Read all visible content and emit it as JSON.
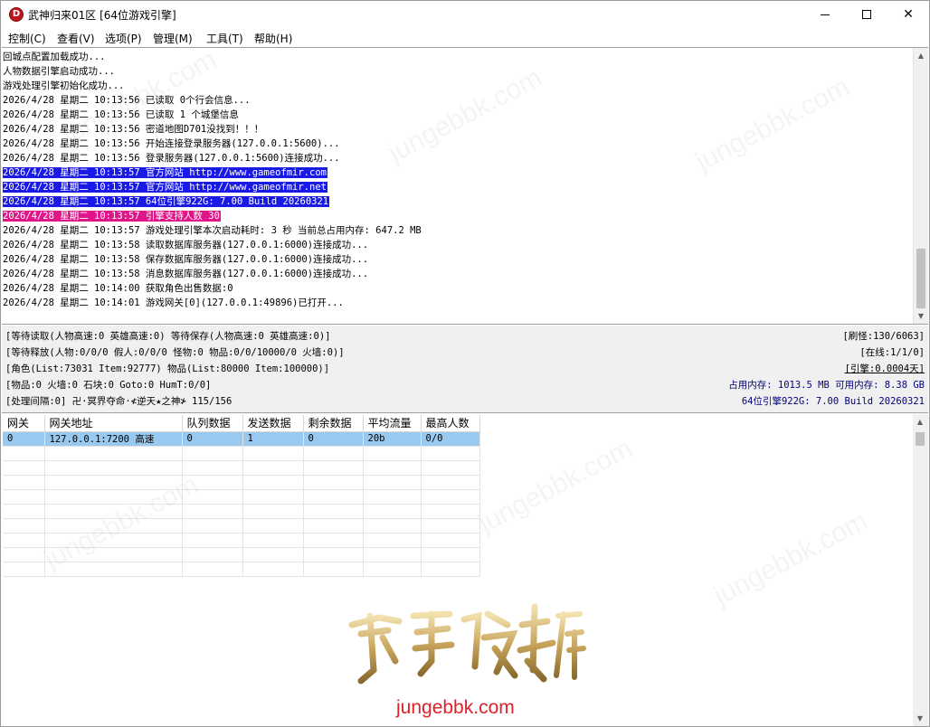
{
  "window": {
    "title": "武神归来01区 [64位游戏引擎]",
    "icon_letter": "D",
    "controls": {
      "minimize": "minimize-icon",
      "maximize": "maximize-icon",
      "close": "✕"
    }
  },
  "menu": [
    "控制(C)",
    "查看(V)",
    "选项(P)",
    "管理(M)",
    "工具(T)",
    "帮助(H)"
  ],
  "log": [
    {
      "text": "回城点配置加载成功...",
      "hl": ""
    },
    {
      "text": "人物数据引擎启动成功...",
      "hl": ""
    },
    {
      "text": "游戏处理引擎初始化成功...",
      "hl": ""
    },
    {
      "text": "2026/4/28 星期二 10:13:56 已读取 0个行会信息...",
      "hl": ""
    },
    {
      "text": "2026/4/28 星期二 10:13:56 已读取 1 个城堡信息",
      "hl": ""
    },
    {
      "text": "2026/4/28 星期二 10:13:56 密道地图D701没找到！！！",
      "hl": ""
    },
    {
      "text": "2026/4/28 星期二 10:13:56 开始连接登录服务器(127.0.0.1:5600)...",
      "hl": ""
    },
    {
      "text": "2026/4/28 星期二 10:13:56 登录服务器(127.0.0.1:5600)连接成功...",
      "hl": ""
    },
    {
      "text": "2026/4/28 星期二 10:13:57 官方网站 http://www.gameofmir.com",
      "hl": "blue"
    },
    {
      "text": "2026/4/28 星期二 10:13:57 官方网站 http://www.gameofmir.net",
      "hl": "blue"
    },
    {
      "text": "2026/4/28 星期二 10:13:57 64位引擎922G: 7.00 Build 20260321",
      "hl": "blue"
    },
    {
      "text": "2026/4/28 星期二 10:13:57 引擎支持人数 30",
      "hl": "pink"
    },
    {
      "text": "2026/4/28 星期二 10:13:57 游戏处理引擎本次启动耗时: 3 秒 当前总占用内存: 647.2 MB",
      "hl": ""
    },
    {
      "text": "2026/4/28 星期二 10:13:58 读取数据库服务器(127.0.0.1:6000)连接成功...",
      "hl": ""
    },
    {
      "text": "2026/4/28 星期二 10:13:58 保存数据库服务器(127.0.0.1:6000)连接成功...",
      "hl": ""
    },
    {
      "text": "2026/4/28 星期二 10:13:58 消息数据库服务器(127.0.0.1:6000)连接成功...",
      "hl": ""
    },
    {
      "text": "2026/4/28 星期二 10:14:00 获取角色出售数据:0",
      "hl": ""
    },
    {
      "text": "2026/4/28 星期二 10:14:01 游戏网关[0](127.0.0.1:49896)已打开...",
      "hl": ""
    }
  ],
  "status": {
    "line1": "[等待读取(人物高速:0 英雄高速:0) 等待保存(人物高速:0 英雄高速:0)]",
    "line2": "[等待释放(人物:0/0/0 假人:0/0/0 怪物:0 物品:0/0/10000/0 火墙:0)]",
    "line3": "[角色(List:73031 Item:92777) 物品(List:80000 Item:100000)]",
    "line4": "[物品:0 火墙:0 石块:0 Goto:0 HumT:0/0]",
    "line5": "[处理间隔:0]  卍·冥界夺命·≮逆天★之神≯ 115/156",
    "refresh": "[刷怪:130/6063]",
    "online": "[在线:1/1/0]",
    "engine": "[引擎:0.0004天]",
    "memory": "占用内存: 1013.5 MB 可用内存: 8.38 GB",
    "build": "64位引擎922G: 7.00 Build 20260321"
  },
  "grid": {
    "columns": [
      "网关",
      "网关地址",
      "队列数据",
      "发送数据",
      "剩余数据",
      "平均流量",
      "最高人数"
    ],
    "rows": [
      [
        "0",
        "127.0.0.1:7200 高速",
        "0",
        "1",
        "0",
        "20b",
        "0/0"
      ]
    ]
  },
  "watermark": {
    "logo_text": "军哥版本库",
    "url": "jungebbk.com",
    "faint": "jungebbk.com"
  },
  "colors": {
    "highlight_blue": "#1a1ae6",
    "highlight_pink": "#e0158a",
    "selected_row": "#99c9ef",
    "status_navy": "#000080",
    "watermark_red": "#e0202a"
  }
}
